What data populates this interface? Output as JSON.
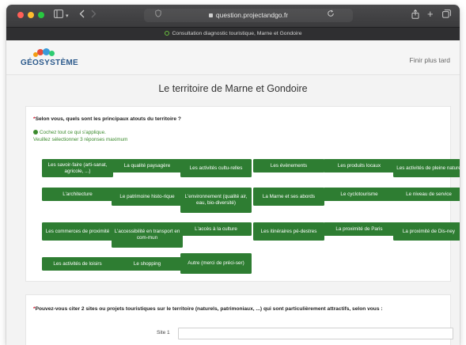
{
  "browser": {
    "url": "question.projectandgo.fr",
    "tab_title": "Consultation diagnostic touristique, Marne et Gondoire"
  },
  "header": {
    "logo_text": "GÉOSYSTÈME",
    "finish_later": "Finir plus tard"
  },
  "page": {
    "title": "Le territoire de Marne et Gondoire"
  },
  "question1": {
    "required_mark": "*",
    "text": "Selon vous, quels sont les principaux atouts du territoire ?",
    "hint1": "Cochez tout ce qui s'applique.",
    "hint2": "Veuillez sélectionner 3 réponses maximum",
    "options": [
      "Les savoir-faire (arti-sanat, agricole, ...)",
      "La qualité paysagère",
      "Les activités cultu-relles",
      "Les évènements",
      "Les produits locaux",
      "Les activités de pleine nature",
      "L'architecture",
      "Le patrimoine histo-rique",
      "L'environnement (qualité air, eau, bio-diversité)",
      "La Marne et ses abords",
      "Le cyclotourisme",
      "Le niveau de service",
      "Les commerces de proximité",
      "L'accessibilité en transport en com-mun",
      "L'accès à la culture",
      "Les itinéraires pé-destres",
      "La proximité de Paris",
      "La proximité de Dis-ney",
      "Les activités de loisirs",
      "Le shopping",
      "Autre (merci de préci-ser)"
    ]
  },
  "question2": {
    "required_mark": "*",
    "text": "Pouvez-vous citer 2 sites ou projets touristiques sur le territoire (naturels, patrimoniaux, ...) qui sont particulièrement attractifs, selon vous :",
    "site1_label": "Site 1"
  },
  "colors": {
    "option_green": "#2e7d32",
    "hint_green": "#3a8a2c",
    "required_red": "#d0021b",
    "logo_blue": "#2c5a8c"
  }
}
